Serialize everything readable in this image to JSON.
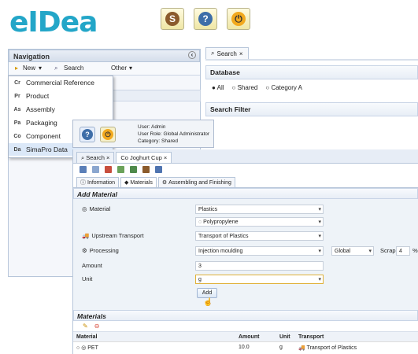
{
  "logo": {
    "text": "eIDea"
  },
  "topButtons": [
    "S",
    "?",
    "⏻"
  ],
  "nav": {
    "title": "Navigation",
    "collapse": "‹",
    "new": "New",
    "search": "Search",
    "other": "Other",
    "menu": [
      {
        "code": "Cr",
        "label": "Commercial Reference"
      },
      {
        "code": "Pr",
        "label": "Product"
      },
      {
        "code": "As",
        "label": "Assembly"
      },
      {
        "code": "Pa",
        "label": "Packaging"
      },
      {
        "code": "Co",
        "label": "Component"
      },
      {
        "code": "Da",
        "label": "SimaPro Data"
      }
    ]
  },
  "searchWindow": {
    "tab": "Search",
    "database": "Database",
    "radioAll": "All",
    "radioShared": "Shared",
    "radioCategory": "Category A",
    "filter": "Search Filter"
  },
  "popup": {
    "userLabel": "User:",
    "userValue": "Admin",
    "roleLabel": "User Role:",
    "roleValue": "Global Administrator",
    "categoryLabel": "Category:",
    "categoryValue": "Shared"
  },
  "main": {
    "tabSearch": "Search",
    "tabActive": "Joghurt Cup",
    "subtabs": [
      "Information",
      "Materials",
      "Assembling and Finishing"
    ],
    "addMaterial": "Add Material",
    "materialLabel": "Material",
    "materialValue": "Plastics",
    "materialSub": "Polypropylene",
    "transportLabel": "Upstream Transport",
    "transportValue": "Transport of Plastics",
    "processingLabel": "Processing",
    "processingValue": "Injection moulding",
    "scope": "Global",
    "scrapLabel": "Scrap",
    "scrapValue": "4",
    "percent": "%",
    "amountLabel": "Amount",
    "amountValue": "3",
    "unitLabel": "Unit",
    "unitValue": "g",
    "addButton": "Add",
    "materialsSection": "Materials",
    "tableHeaders": [
      "Material",
      "Amount",
      "Unit",
      "Transport"
    ],
    "rows": [
      {
        "material": "PET",
        "amount": "10.0",
        "unit": "g",
        "transport": "Transport of Plastics"
      }
    ]
  },
  "colors": {
    "logo": "#23a6c8",
    "accent": "#315a8a",
    "selection": "#dbe8f8"
  }
}
